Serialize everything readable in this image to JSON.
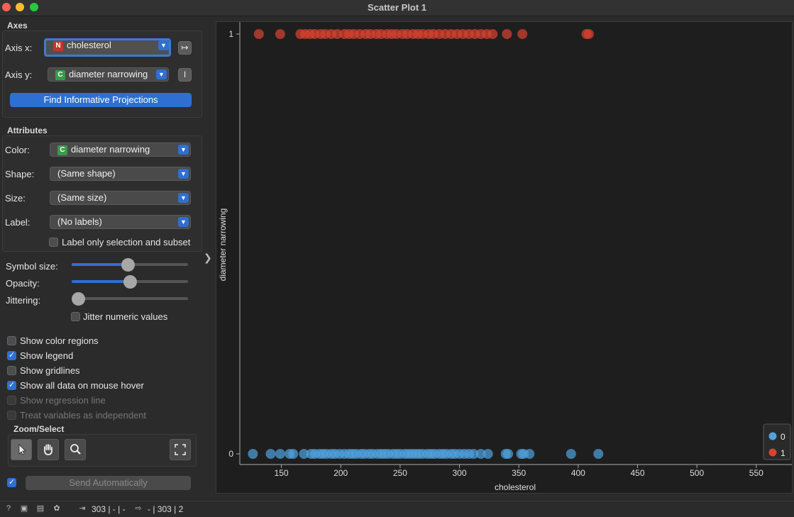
{
  "window": {
    "title": "Scatter Plot 1"
  },
  "axes_group": {
    "title": "Axes",
    "x_label": "Axis x:",
    "x_badge": "N",
    "x_value": "cholesterol",
    "y_label": "Axis y:",
    "y_badge": "C",
    "y_value": "diameter narrowing",
    "find_button": "Find Informative Projections"
  },
  "attributes_group": {
    "title": "Attributes",
    "color_label": "Color:",
    "color_badge": "C",
    "color_value": "diameter narrowing",
    "shape_label": "Shape:",
    "shape_value": "(Same shape)",
    "size_label": "Size:",
    "size_value": "(Same size)",
    "label_label": "Label:",
    "label_value": "(No labels)",
    "label_only_selection": "Label only selection and subset"
  },
  "sliders": {
    "symbol_size_label": "Symbol size:",
    "symbol_size": 0.48,
    "opacity_label": "Opacity:",
    "opacity": 0.5,
    "jittering_label": "Jittering:",
    "jittering": 0.0,
    "jitter_numeric": "Jitter numeric values"
  },
  "options": [
    {
      "label": "Show color regions",
      "checked": false,
      "disabled": false
    },
    {
      "label": "Show legend",
      "checked": true,
      "disabled": false
    },
    {
      "label": "Show gridlines",
      "checked": false,
      "disabled": false
    },
    {
      "label": "Show all data on mouse hover",
      "checked": true,
      "disabled": false
    },
    {
      "label": "Show regression line",
      "checked": false,
      "disabled": true
    },
    {
      "label": "Treat variables as independent",
      "checked": false,
      "disabled": true
    }
  ],
  "zoom_group": {
    "title": "Zoom/Select"
  },
  "send": {
    "label": "Send Automatically",
    "checked": true
  },
  "status": {
    "input": "303 | - | -",
    "output": "- | 303 | 2"
  },
  "chart_data": {
    "type": "scatter",
    "xlabel": "cholesterol",
    "ylabel": "diameter narrowing",
    "xlim": [
      115,
      580
    ],
    "x_ticks": [
      150,
      200,
      250,
      300,
      350,
      400,
      450,
      500,
      550
    ],
    "y_ticks": [
      "0",
      "1"
    ],
    "grid": false,
    "legend_position": "bottom-right",
    "colors": {
      "0": "#4fa3e0",
      "1": "#d8432f"
    },
    "series": [
      {
        "name": "0",
        "y": 0,
        "x": [
          126,
          141,
          149,
          157,
          160,
          169,
          175,
          178,
          182,
          185,
          188,
          192,
          195,
          199,
          203,
          207,
          210,
          213,
          217,
          220,
          224,
          227,
          231,
          234,
          237,
          240,
          244,
          247,
          250,
          254,
          257,
          260,
          263,
          266,
          269,
          273,
          276,
          279,
          283,
          286,
          289,
          293,
          296,
          300,
          304,
          308,
          312,
          318,
          324,
          339,
          341,
          352,
          354,
          359,
          394,
          417
        ]
      },
      {
        "name": "1",
        "y": 1,
        "x": [
          131,
          149,
          166,
          170,
          174,
          178,
          183,
          187,
          192,
          197,
          203,
          207,
          211,
          216,
          221,
          225,
          230,
          234,
          239,
          243,
          247,
          252,
          256,
          261,
          265,
          269,
          274,
          278,
          283,
          288,
          293,
          298,
          303,
          308,
          313,
          318,
          323,
          328,
          340,
          353,
          407,
          409
        ]
      }
    ]
  }
}
